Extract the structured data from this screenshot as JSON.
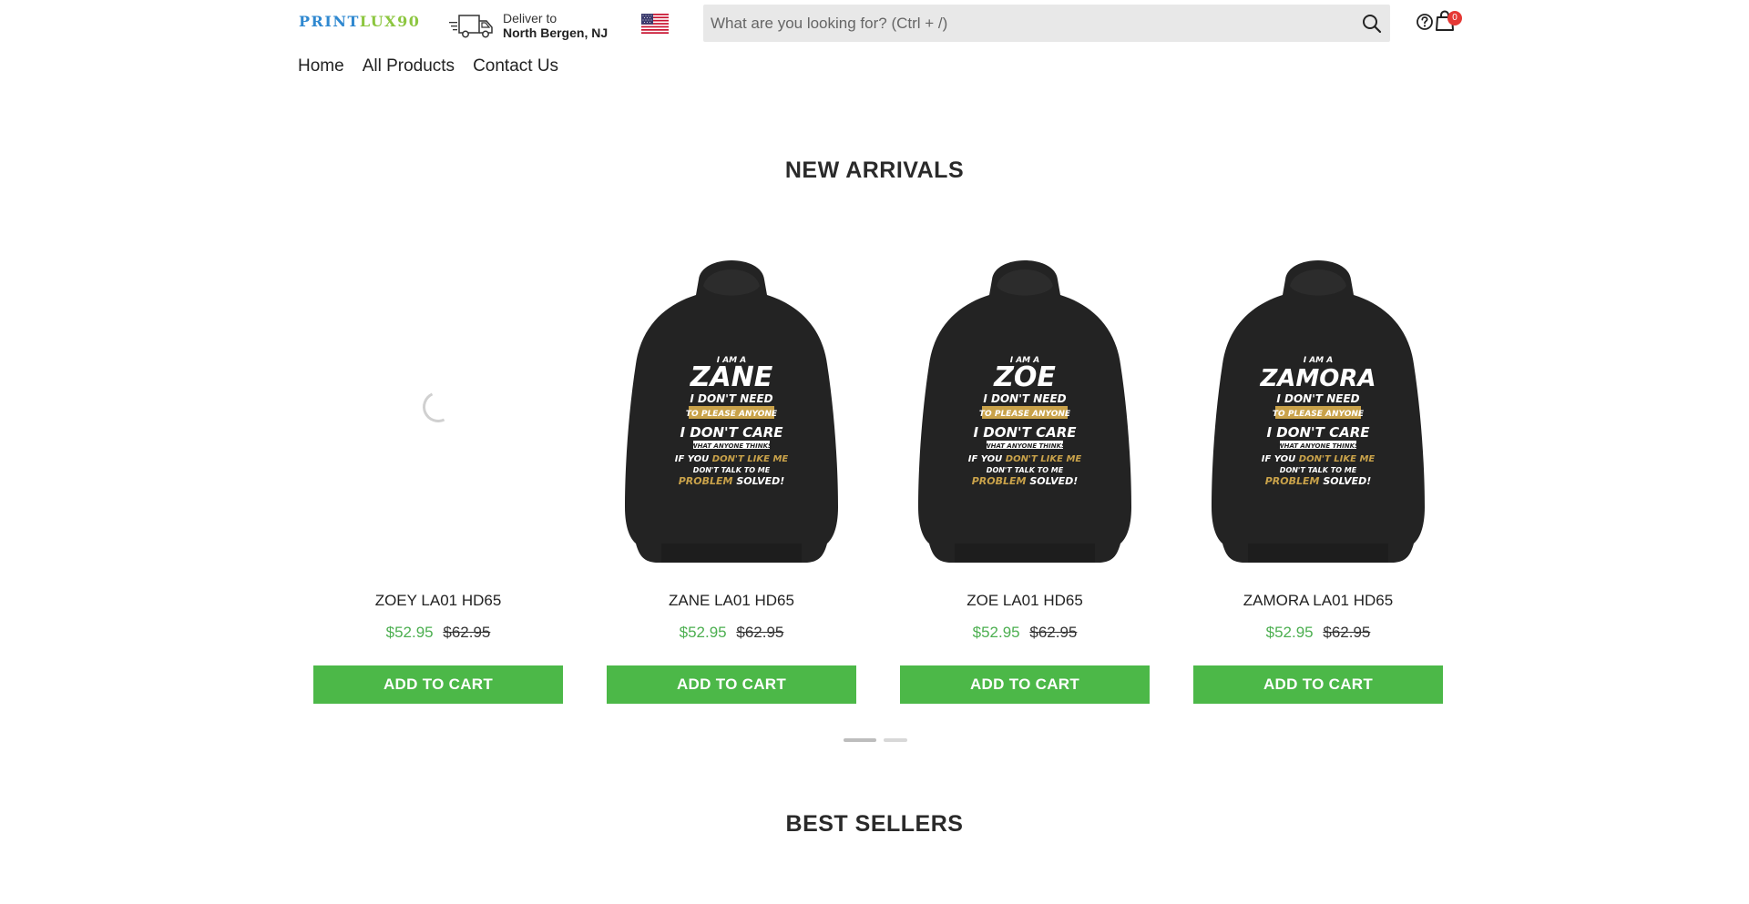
{
  "header": {
    "logo": {
      "part1": "PRINT",
      "part2": "LUX90"
    },
    "deliver": {
      "line1": "Deliver to",
      "line2": "North Bergen, NJ",
      "icon": "truck-icon"
    },
    "flag": "us-flag-icon",
    "search": {
      "placeholder": "What are you looking for? (Ctrl + /)",
      "value": "",
      "icon": "search-icon"
    },
    "help_icon": "help-circle-icon",
    "cart": {
      "icon": "shopping-bag-icon",
      "count": "0"
    }
  },
  "nav": {
    "items": [
      {
        "label": "Home"
      },
      {
        "label": "All Products"
      },
      {
        "label": "Contact Us"
      }
    ]
  },
  "sections": {
    "new_arrivals": "NEW ARRIVALS",
    "best_sellers": "BEST SELLERS"
  },
  "products": [
    {
      "name": "ZOEY LA01 HD65",
      "sale_price": "$52.95",
      "regular_price": "$62.95",
      "button": "ADD TO CART",
      "image_loading": true,
      "print_name": ""
    },
    {
      "name": "ZANE LA01 HD65",
      "sale_price": "$52.95",
      "regular_price": "$62.95",
      "button": "ADD TO CART",
      "image_loading": false,
      "print_name": "ZANE"
    },
    {
      "name": "ZOE LA01 HD65",
      "sale_price": "$52.95",
      "regular_price": "$62.95",
      "button": "ADD TO CART",
      "image_loading": false,
      "print_name": "ZOE"
    },
    {
      "name": "ZAMORA LA01 HD65",
      "sale_price": "$52.95",
      "regular_price": "$62.95",
      "button": "ADD TO CART",
      "image_loading": false,
      "print_name": "ZAMORA"
    }
  ],
  "hoodie_print": {
    "line1": "I AM A",
    "line2": "I DON'T NEED",
    "line3": "TO PLEASE ANYONE",
    "line4": "I DON'T CARE",
    "line5": "WHAT ANYONE THINKS",
    "line6a": "IF YOU",
    "line6b": "DON'T LIKE ME",
    "line7": "DON'T TALK TO ME",
    "line8a": "PROBLEM",
    "line8b": "SOLVED!"
  },
  "carousel": {
    "pages": 2,
    "active": 1
  },
  "colors": {
    "accent_green": "#4cb848",
    "sale_green": "#4caf50",
    "badge_red": "#e53935",
    "logo_blue": "#2f88d0",
    "logo_green": "#8cc63f"
  }
}
